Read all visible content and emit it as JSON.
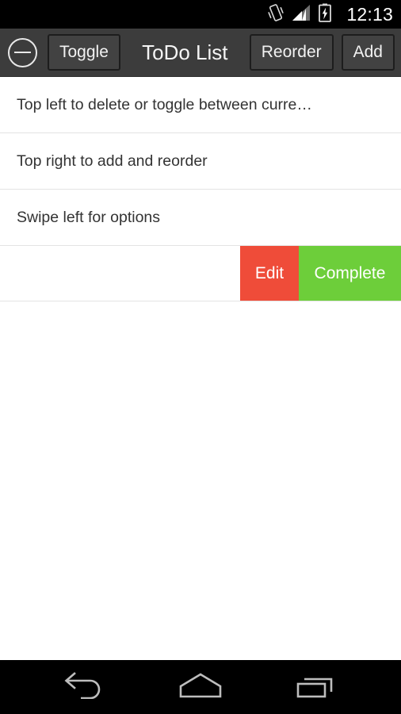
{
  "status_bar": {
    "time": "12:13",
    "icons": [
      {
        "name": "vibrate-icon",
        "label": "vibrate"
      },
      {
        "name": "signal-icon",
        "label": "signal-strength"
      },
      {
        "name": "battery-charging-icon",
        "label": "battery-charging"
      }
    ],
    "background": "#000000",
    "text_color": "#ffffff"
  },
  "action_bar": {
    "title": "ToDo List",
    "delete_icon_name": "minus-circle-icon",
    "toggle_label": "Toggle",
    "reorder_label": "Reorder",
    "add_label": "Add",
    "background": "#3c3c3c",
    "button_background": "#424242",
    "button_border": "#1d1d1d",
    "text_color": "#f5f5f5"
  },
  "list": {
    "items": [
      {
        "text": "Top left to delete or toggle between curre…",
        "truncated": true
      },
      {
        "text": "Top right to add and reorder",
        "truncated": false
      },
      {
        "text": "Swipe left for options",
        "truncated": false
      }
    ],
    "swipe_row": {
      "text": "",
      "edit_label": "Edit",
      "complete_label": "Complete",
      "edit_color": "#ef4c39",
      "complete_color": "#6dce3a"
    },
    "divider_color": "#e3e3e3",
    "text_color": "#333333",
    "background": "#ffffff"
  },
  "nav_bar": {
    "background": "#000000",
    "icon_color": "#bdbdbd",
    "buttons": [
      {
        "name": "back-button",
        "label": "Back"
      },
      {
        "name": "home-button",
        "label": "Home"
      },
      {
        "name": "recents-button",
        "label": "Recent apps"
      }
    ]
  }
}
